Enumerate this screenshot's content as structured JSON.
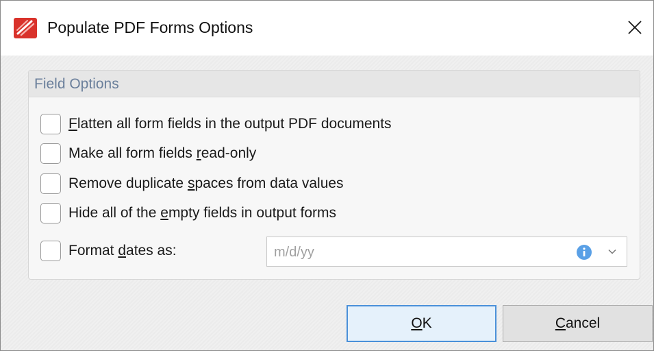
{
  "window": {
    "title": "Populate PDF Forms Options",
    "close_icon": "close-icon",
    "app_icon": "pdf-app-icon"
  },
  "group": {
    "title": "Field Options"
  },
  "options": [
    {
      "pre": "",
      "u": "F",
      "post": "latten all form fields in the output PDF documents",
      "checked": false
    },
    {
      "pre": "Make all form fields ",
      "u": "r",
      "post": "ead-only",
      "checked": false
    },
    {
      "pre": "Remove duplicate ",
      "u": "s",
      "post": "paces from data values",
      "checked": false
    },
    {
      "pre": "Hide all of the ",
      "u": "e",
      "post": "mpty fields in output forms",
      "checked": false
    },
    {
      "pre": "Format ",
      "u": "d",
      "post": "ates as:",
      "checked": false
    }
  ],
  "date_format": {
    "value": "m/d/yy",
    "info_icon": "info-icon",
    "dropdown_icon": "chevron-down-icon",
    "info_color": "#5aa0e6"
  },
  "buttons": {
    "ok": {
      "u": "O",
      "post": "K"
    },
    "cancel": {
      "u": "C",
      "post": "ancel"
    }
  },
  "colors": {
    "group_title": "#6a7f9b",
    "ok_border": "#4a90d9",
    "app_icon_red": "#d9322b"
  }
}
